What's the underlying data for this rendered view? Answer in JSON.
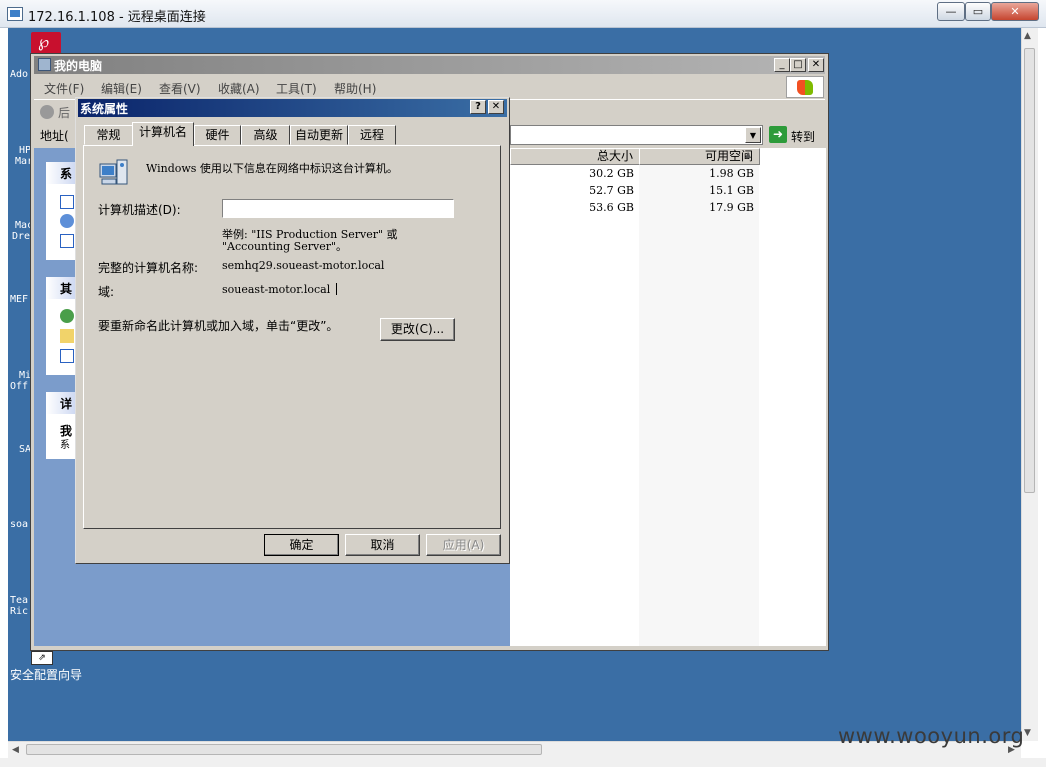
{
  "rdp": {
    "title": "172.16.1.108 - 远程桌面连接",
    "controls": {
      "minimize": "—",
      "maximize": "▭",
      "close": "✕"
    }
  },
  "desktop": {
    "icons": [
      {
        "label": "Ado"
      },
      {
        "label": "HP"
      },
      {
        "label": "Mar"
      },
      {
        "label": "Mac"
      },
      {
        "label": "Dre"
      },
      {
        "label": "MEF"
      },
      {
        "label": "Mi"
      },
      {
        "label": "Off"
      },
      {
        "label": "SA"
      },
      {
        "label": "soa"
      },
      {
        "label": "Tea"
      },
      {
        "label": "Ric"
      }
    ],
    "wizard_label": "安全配置向导"
  },
  "my_computer": {
    "title": "我的电脑",
    "menu": [
      "文件(F)",
      "编辑(E)",
      "查看(V)",
      "收藏(A)",
      "工具(T)",
      "帮助(H)"
    ],
    "back_label": "后",
    "address_label": "地址(",
    "go_label": "转到",
    "left_pane": {
      "section1": "系",
      "section2": "其",
      "section3": "详",
      "detail_title": "我",
      "detail_sub": "系"
    },
    "columns": {
      "total": "总大小",
      "free": "可用空间"
    },
    "rows": [
      {
        "total": "30.2 GB",
        "free": "1.98 GB"
      },
      {
        "total": "52.7 GB",
        "free": "15.1 GB"
      },
      {
        "total": "53.6 GB",
        "free": "17.9 GB"
      }
    ]
  },
  "dialog": {
    "title": "系统属性",
    "help": "?",
    "close": "✕",
    "tabs": [
      "常规",
      "计算机名",
      "硬件",
      "高级",
      "自动更新",
      "远程"
    ],
    "intro": "Windows 使用以下信息在网络中标识这台计算机。",
    "desc_label": "计算机描述(D):",
    "desc_value": "",
    "example_line1": "举例: \"IIS Production Server\" 或",
    "example_line2": "\"Accounting Server\"。",
    "full_name_label": "完整的计算机名称:",
    "full_name_value": "semhq29.soueast-motor.local",
    "domain_label": "域:",
    "domain_value": "soueast-motor.local",
    "rename_text": "要重新命名此计算机或加入域，单击“更改”。",
    "change_button": "更改(C)...",
    "ok_button": "确定",
    "cancel_button": "取消",
    "apply_button": "应用(A)"
  },
  "watermark": "www.wooyun.org"
}
